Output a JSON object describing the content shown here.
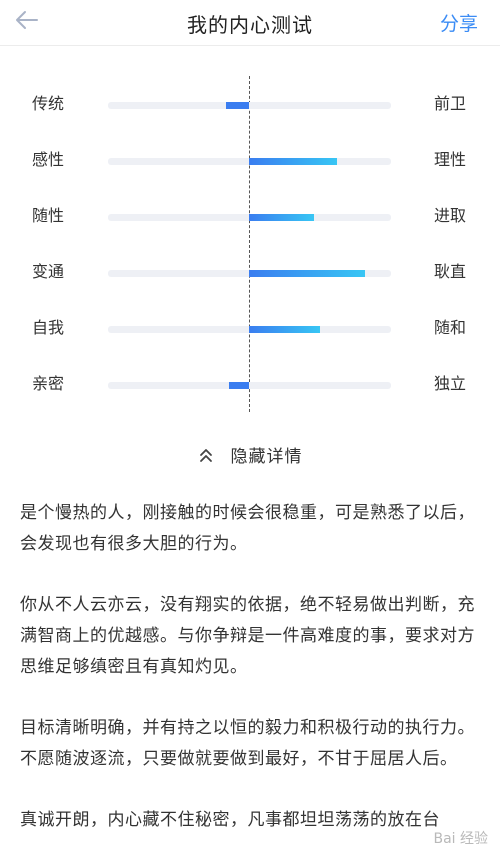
{
  "header": {
    "title": "我的内心测试",
    "share_label": "分享"
  },
  "traits": [
    {
      "left": "传统",
      "right": "前卫",
      "value": -0.08
    },
    {
      "left": "感性",
      "right": "理性",
      "value": 0.31
    },
    {
      "left": "随性",
      "right": "进取",
      "value": 0.23
    },
    {
      "left": "变通",
      "right": "耿直",
      "value": 0.41
    },
    {
      "left": "自我",
      "right": "随和",
      "value": 0.25
    },
    {
      "left": "亲密",
      "right": "独立",
      "value": -0.07
    }
  ],
  "toggle": {
    "label": "隐藏详情"
  },
  "paragraphs": [
    "是个慢热的人，刚接触的时候会很稳重，可是熟悉了以后，会发现也有很多大胆的行为。",
    "你从不人云亦云，没有翔实的依据，绝不轻易做出判断，充满智商上的优越感。与你争辩是一件高难度的事，要求对方思维足够缜密且有真知灼见。",
    "目标清晰明确，并有持之以恒的毅力和积极行动的执行力。不愿随波逐流，只要做就要做到最好，不甘于屈居人后。",
    "真诚开朗，内心藏不住秘密，凡事都坦坦荡荡的放在台"
  ],
  "watermark": "Bai 经验",
  "colors": {
    "accent": "#3b8cf5",
    "bar_start": "#3a7df0",
    "bar_end": "#38c6f4",
    "track": "#eef0f5"
  },
  "icons": {
    "back": "back-arrow-icon",
    "toggle": "double-chevron-up-icon"
  }
}
